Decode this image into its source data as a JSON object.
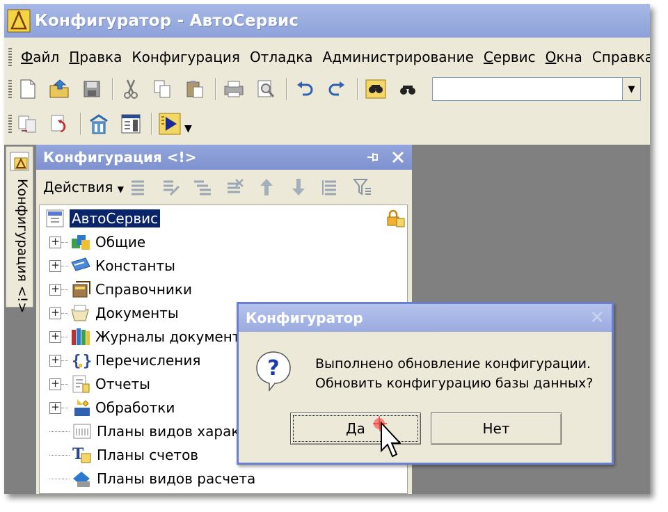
{
  "window": {
    "title": "Конфигуратор - АвтоСервис"
  },
  "menu": {
    "items": [
      {
        "label": "Файл",
        "underline": "Ф"
      },
      {
        "label": "Правка",
        "underline": "П"
      },
      {
        "label": "Конфигурация",
        "underline": ""
      },
      {
        "label": "Отладка",
        "underline": ""
      },
      {
        "label": "Администрирование",
        "underline": ""
      },
      {
        "label": "Сервис",
        "underline": "С"
      },
      {
        "label": "Окна",
        "underline": "О"
      },
      {
        "label": "Справка",
        "underline": ""
      }
    ]
  },
  "toolbar": {
    "search_value": "",
    "icons": [
      "new-document-icon",
      "open-folder-icon",
      "save-icon",
      "cut-icon",
      "copy-icon",
      "paste-icon",
      "print-icon",
      "preview-icon",
      "undo-icon",
      "redo-icon",
      "find-in-tree-icon",
      "find-icon"
    ]
  },
  "toolbar2": {
    "icons": [
      "compare-config-icon",
      "update-config-icon",
      "database-config-icon",
      "window-list-icon",
      "run-debug-icon"
    ]
  },
  "sidebar_tab": {
    "label": "Конфигурация <!>"
  },
  "panel": {
    "title": "Конфигурация <!>",
    "actions_label": "Действия",
    "tree": {
      "root": "АвтоСервис",
      "items": [
        {
          "label": "Общие",
          "expandable": true,
          "icon": "common-icon"
        },
        {
          "label": "Константы",
          "expandable": true,
          "icon": "constants-icon"
        },
        {
          "label": "Справочники",
          "expandable": true,
          "icon": "catalogs-icon"
        },
        {
          "label": "Документы",
          "expandable": true,
          "icon": "documents-icon"
        },
        {
          "label": "Журналы документов",
          "expandable": true,
          "icon": "journals-icon"
        },
        {
          "label": "Перечисления",
          "expandable": true,
          "icon": "enums-icon"
        },
        {
          "label": "Отчеты",
          "expandable": true,
          "icon": "reports-icon"
        },
        {
          "label": "Обработки",
          "expandable": true,
          "icon": "dataprocessors-icon"
        },
        {
          "label": "Планы видов характеристик",
          "expandable": false,
          "icon": "chart-of-characteristics-icon"
        },
        {
          "label": "Планы счетов",
          "expandable": false,
          "icon": "chart-of-accounts-icon"
        },
        {
          "label": "Планы видов расчета",
          "expandable": false,
          "icon": "chart-of-calculation-icon"
        }
      ]
    }
  },
  "dialog": {
    "title": "Конфигуратор",
    "line1": "Выполнено обновление конфигурации.",
    "line2": "Обновить конфигурацию базы данных?",
    "yes_label": "Да",
    "no_label": "Нет"
  },
  "colors": {
    "title_bar": "#8ea2da",
    "selection": "#0a246a",
    "chrome": "#ece9d8",
    "workspace": "#808080"
  }
}
